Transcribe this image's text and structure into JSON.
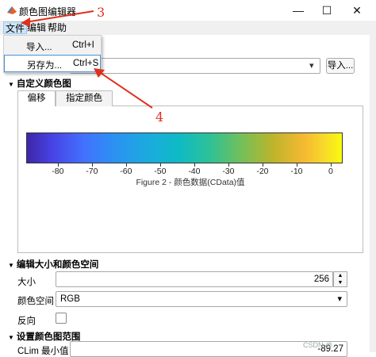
{
  "window": {
    "title": "颜色图编辑器",
    "controls": {
      "minimize": "—",
      "maximize": "☐",
      "close": "✕"
    }
  },
  "menubar": {
    "items": [
      {
        "label": "文件"
      },
      {
        "label": "编辑"
      },
      {
        "label": "帮助"
      }
    ]
  },
  "file_menu": {
    "items": [
      {
        "label": "导入...",
        "shortcut": "Ctrl+I"
      },
      {
        "label": "另存为...",
        "shortcut": "Ctrl+S"
      }
    ]
  },
  "colormap_row": {
    "select_value": "",
    "import_button": "导入..."
  },
  "custom_colormap": {
    "section_title": "自定义颜色图",
    "tabs": [
      {
        "label": "偏移"
      },
      {
        "label": "指定颜色"
      }
    ],
    "selected_tab": 0
  },
  "chart_data": {
    "type": "heatmap",
    "title": "",
    "colormap": [
      "#3e26a8",
      "#4743e4",
      "#4271fe",
      "#2b92f2",
      "#1caadf",
      "#0ebac6",
      "#2dc197",
      "#72c05a",
      "#bcb42b",
      "#f5b931",
      "#f8d72b",
      "#f9fb0e"
    ],
    "xlim": [
      -89.27,
      3.5
    ],
    "ticks": [
      -80,
      -70,
      -60,
      -50,
      -40,
      -30,
      -20,
      -10,
      0
    ],
    "tick_labels": [
      "-80",
      "-70",
      "-60",
      "-50",
      "-40",
      "-30",
      "-20",
      "-10",
      "0"
    ],
    "xlabel": "Figure 2 - 颜色数据(CData)值"
  },
  "size_space": {
    "section_title": "编辑大小和颜色空间",
    "size_label": "大小",
    "size_value": "256",
    "space_label": "颜色空间",
    "space_value": "RGB",
    "reverse_label": "反向"
  },
  "clim": {
    "section_title": "设置颜色图范围",
    "min_label": "CLim 最小值",
    "min_value": "-89.27"
  },
  "annotations": {
    "arrow3": "3",
    "arrow4": "4"
  },
  "watermark": "CSDN @..."
}
